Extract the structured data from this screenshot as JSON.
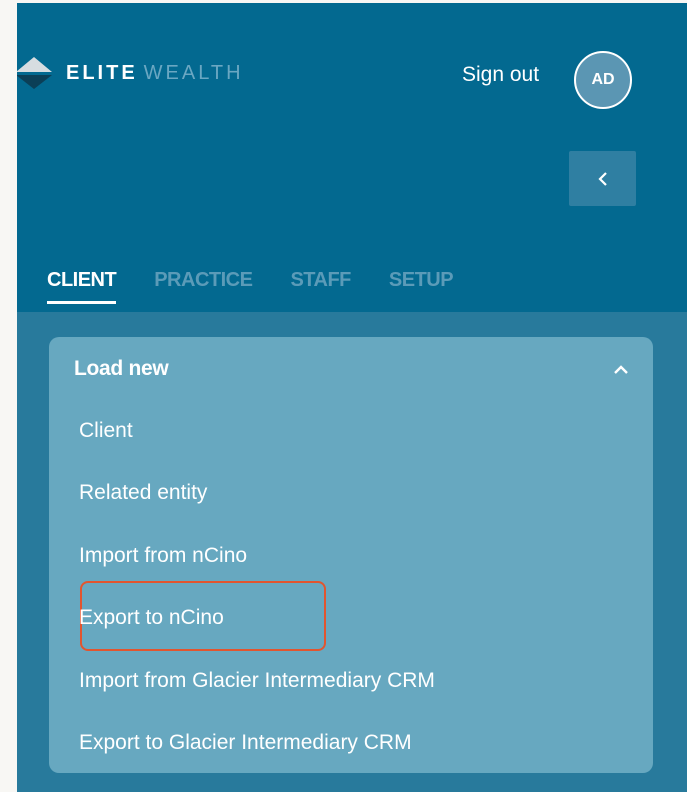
{
  "brand": {
    "name_bold": "ELITE",
    "name_light": "WEALTH"
  },
  "header": {
    "signout_label": "Sign out",
    "avatar_initials": "AD",
    "collapse_icon": "chevron-left-icon"
  },
  "tabs": [
    {
      "label": "CLIENT",
      "active": true
    },
    {
      "label": "PRACTICE",
      "active": false
    },
    {
      "label": "STAFF",
      "active": false
    },
    {
      "label": "SETUP",
      "active": false
    }
  ],
  "section": {
    "title": "Load new",
    "expanded": true,
    "toggle_icon": "chevron-up-icon",
    "items": [
      {
        "label": "Client"
      },
      {
        "label": "Related entity"
      },
      {
        "label": "Import from nCino"
      },
      {
        "label": "Export to nCino",
        "highlighted": true
      },
      {
        "label": "Import from Glacier Intermediary CRM"
      },
      {
        "label": "Export to Glacier Intermediary CRM"
      }
    ]
  },
  "colors": {
    "header_bg": "#036990",
    "nav_bg": "#287a9c",
    "card_bg": "#67a8c0",
    "highlight_border": "#e2552f",
    "inactive_tab": "#5b9bb8"
  }
}
